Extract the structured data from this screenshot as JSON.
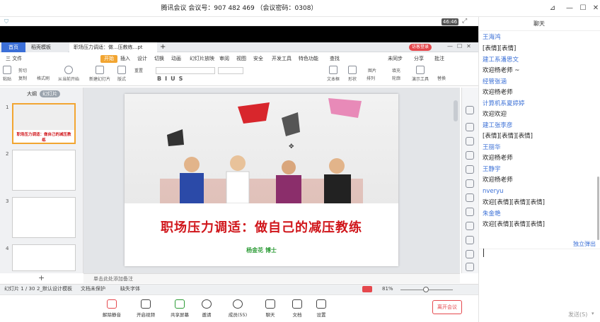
{
  "window": {
    "title": "腾讯会议 会议号：907 482 469 （会议密码：0308）",
    "time": "46:46"
  },
  "wps": {
    "tabs": [
      "首页",
      "稻壳模板",
      "职场压力调适：做...压教练...pt"
    ],
    "login": "访客登录",
    "menu": [
      "三 文件",
      "开始",
      "插入",
      "设计",
      "切换",
      "动画",
      "幻灯片放映",
      "审阅",
      "视图",
      "安全",
      "开发工具",
      "特色功能",
      "查找",
      "未同步",
      "分享",
      "批注"
    ],
    "ribbon": [
      "粘贴",
      "剪切",
      "复制",
      "格式刷",
      "从当前开始",
      "新建幻灯片",
      "版式",
      "重置",
      "文本框",
      "形状",
      "排列",
      "图片",
      "填充",
      "轮廓",
      "演示工具",
      "替换"
    ],
    "panel_tabs": [
      "大纲",
      "幻灯片"
    ],
    "thumb1_title": "职场压力调适：做自己的减压教练",
    "slide_title": "职场压力调适：做自己的减压教练",
    "slide_author": "杨金花 博士",
    "notes_placeholder": "单击此处添加备注",
    "status": {
      "slide": "幻灯片 1 / 30",
      "template": "2_默认设计模板",
      "protect": "文档未保护",
      "font": "缺失字体",
      "zoom": "81%"
    }
  },
  "meeting": {
    "buttons": [
      "解除静音",
      "开启视频",
      "共享屏幕",
      "邀请",
      "成员(55)",
      "聊天",
      "文档",
      "设置"
    ],
    "leave": "离开会议"
  },
  "chat": {
    "title": "聊天",
    "messages": [
      {
        "name": "王海鸿",
        "text": "[表情][表情]"
      },
      {
        "name": "建工系潘思文",
        "text": "欢迎杨老师 ~"
      },
      {
        "name": "经管张涵",
        "text": "欢迎杨老师"
      },
      {
        "name": "计算机系夏婷婷",
        "text": "欢迎欢迎"
      },
      {
        "name": "建工张李彦",
        "text": "[表情][表情][表情]"
      },
      {
        "name": "王丽华",
        "text": "欢迎杨老师"
      },
      {
        "name": "王静宇",
        "text": "欢迎杨老师"
      },
      {
        "name": "nveryu",
        "text": "欢迎[表情][表情][表情]"
      },
      {
        "name": "朱金艳",
        "text": "欢迎[表情][表情][表情]"
      }
    ],
    "popout": "独立弹出",
    "send": "发送(S)"
  }
}
